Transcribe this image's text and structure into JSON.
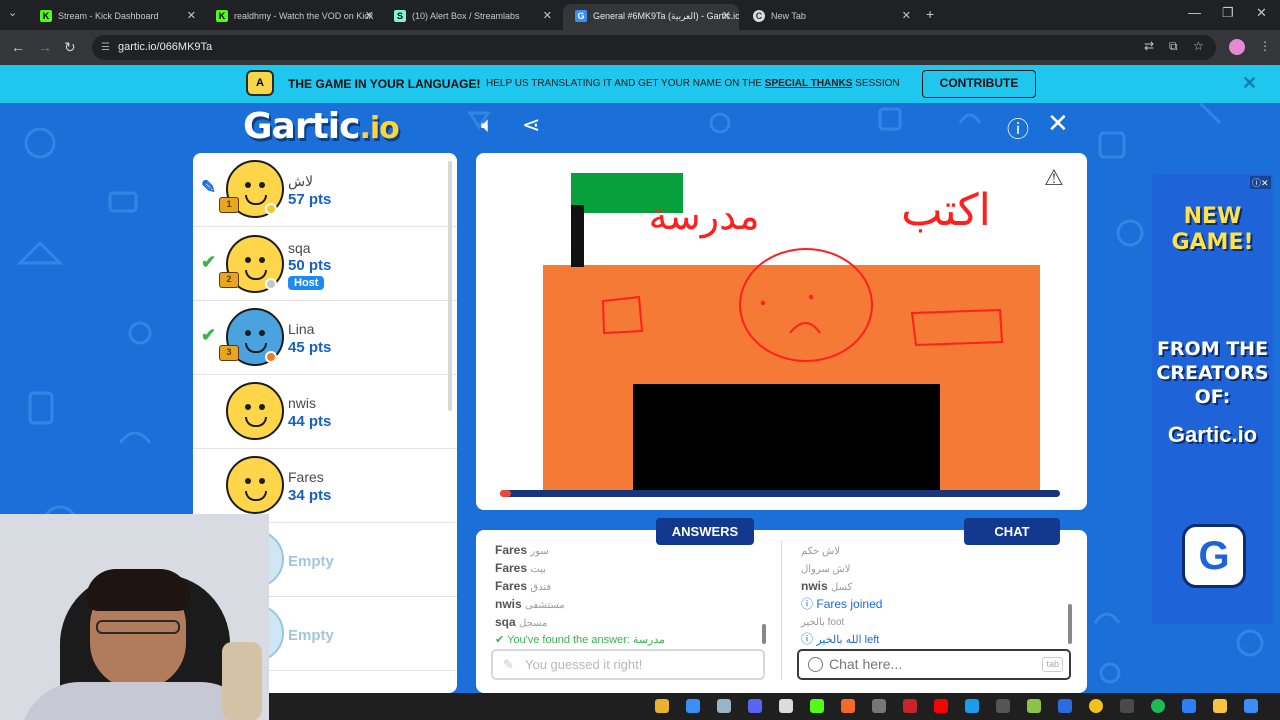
{
  "browser": {
    "tabs": [
      {
        "title": "Stream - Kick Dashboard",
        "favicon": "K"
      },
      {
        "title": "realdhmy - Watch the VOD on Kick",
        "favicon": "K"
      },
      {
        "title": "(10) Alert Box / Streamlabs",
        "favicon": "S"
      },
      {
        "title": "General #6MK9Ta (العربية) - Gartic.io",
        "favicon": "G"
      },
      {
        "title": "New Tab",
        "favicon": "C"
      }
    ],
    "url": "gartic.io/066MK9Ta"
  },
  "banner": {
    "title": "THE GAME IN YOUR LANGUAGE!",
    "text_before": "HELP US TRANSLATING IT AND GET YOUR NAME ON THE",
    "text_link": "SPECIAL THANKS",
    "text_after": "SESSION",
    "button": "CONTRIBUTE",
    "icon_text": "A"
  },
  "logo": {
    "main": "Gartic",
    "suffix": ".io"
  },
  "players": [
    {
      "name": "لاش",
      "points": "57 pts",
      "status": "drawing",
      "dot": "#f6c530"
    },
    {
      "name": "sqa",
      "points": "50 pts",
      "status": "guessed",
      "dot": "#c6c6c6",
      "host": "Host"
    },
    {
      "name": "Lina",
      "points": "45 pts",
      "status": "guessed",
      "dot": "#ef7d1f"
    },
    {
      "name": "nwis",
      "points": "44 pts",
      "status": "none"
    },
    {
      "name": "Fares",
      "points": "34 pts",
      "status": "none"
    }
  ],
  "empty_slots": [
    "Empty",
    "Empty"
  ],
  "canvas": {
    "drawn_text_right": "اكتب",
    "drawn_text_left": "مدرسة",
    "progress": 0.02
  },
  "tabs": {
    "answers": "ANSWERS",
    "chat": "CHAT"
  },
  "answers": [
    {
      "name": "Fares",
      "guess": "سور"
    },
    {
      "name": "Fares",
      "guess": "بيت"
    },
    {
      "name": "Fares",
      "guess": "فندق"
    },
    {
      "name": "nwis",
      "guess": "مستشفى"
    },
    {
      "name": "sqa",
      "guess": "مسجل"
    }
  ],
  "found_message": "You've found the answer: مدرسة",
  "answer_placeholder": "You guessed it right!",
  "chat": [
    {
      "name": "",
      "text": "لاش حكم"
    },
    {
      "name": "",
      "text": "لاش سروال"
    },
    {
      "name": "nwis",
      "text": "كسل"
    },
    {
      "name": "Fares",
      "text": "joined",
      "system": true
    },
    {
      "name": "",
      "text": "بالخير foot"
    },
    {
      "name": "",
      "text": "الله بالخير left",
      "system": true
    }
  ],
  "chat_placeholder": "Chat here...",
  "chat_key_hint": "tab",
  "ad": {
    "line1": "NEW",
    "line2": "GAME!",
    "line3": "FROM THE",
    "line4": "CREATORS",
    "line5": "OF:",
    "logo": "Gartic.io",
    "tile": "G"
  }
}
